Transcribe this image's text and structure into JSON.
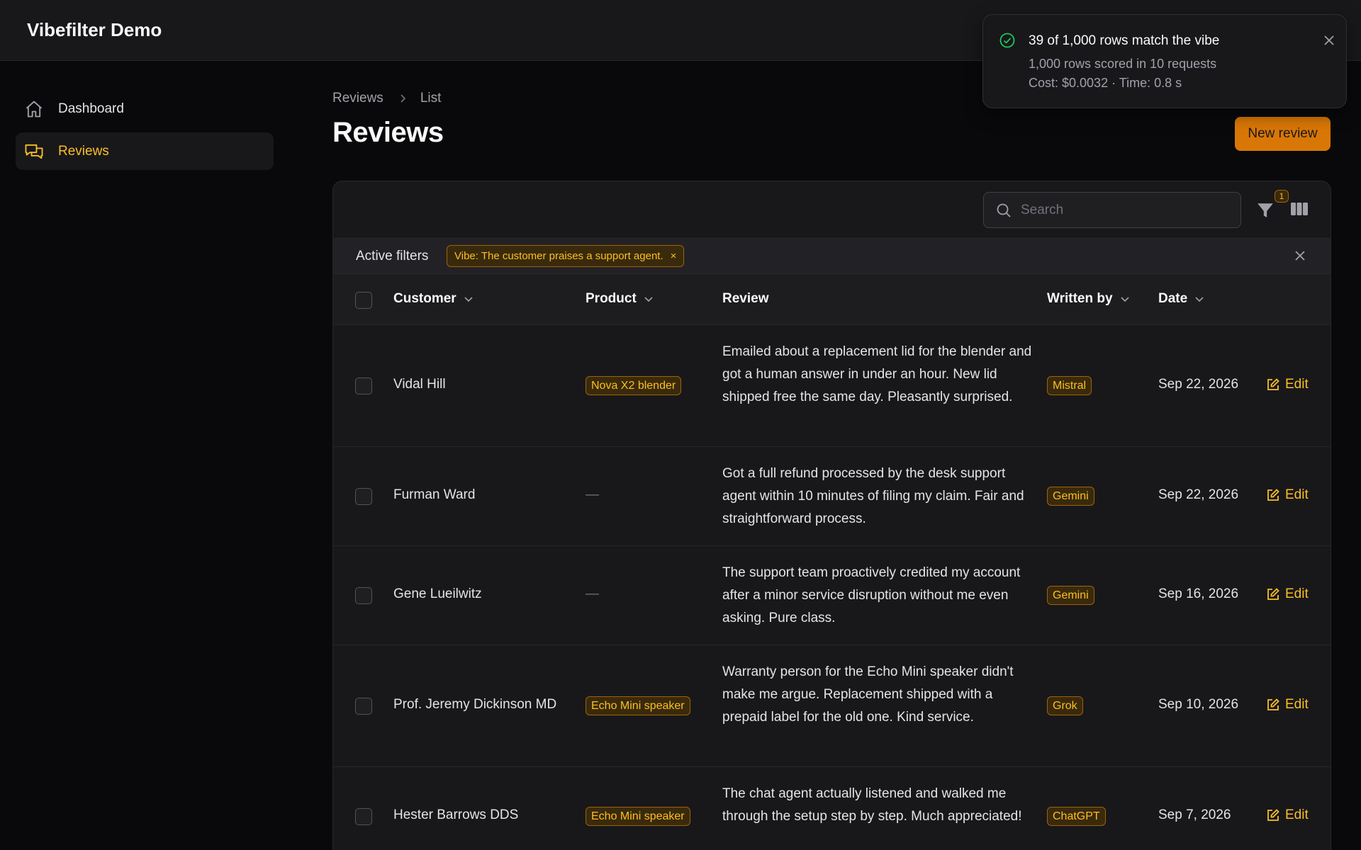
{
  "app": {
    "title": "Vibefilter Demo"
  },
  "sidebar": {
    "items": [
      {
        "label": "Dashboard",
        "icon": "home-icon"
      },
      {
        "label": "Reviews",
        "icon": "chat-bubbles-icon",
        "active": true
      }
    ]
  },
  "breadcrumb": {
    "items": [
      "Reviews",
      "List"
    ]
  },
  "page": {
    "title": "Reviews",
    "new_button": "New review"
  },
  "search": {
    "placeholder": "Search",
    "value": ""
  },
  "toolbar": {
    "filter_count": "1"
  },
  "filters": {
    "label": "Active filters",
    "chips": [
      {
        "label": "Vibe: The customer praises a support agent.",
        "remove": "×"
      }
    ]
  },
  "table": {
    "columns": [
      "Customer",
      "Product",
      "Review",
      "Written by",
      "Date"
    ],
    "empty_product": "—",
    "edit_label": "Edit",
    "rows": [
      {
        "customer": "Vidal Hill",
        "product": "Nova X2 blender",
        "review": "Emailed about a replacement lid for the blender and got a human answer in under an hour. New lid shipped free the same day. Pleasantly surprised.",
        "written_by": "Mistral",
        "date": "Sep 22, 2026"
      },
      {
        "customer": "Furman Ward",
        "product": "",
        "review": "Got a full refund processed by the desk support agent within 10 minutes of filing my claim. Fair and straightforward process.",
        "written_by": "Gemini",
        "date": "Sep 22, 2026"
      },
      {
        "customer": "Gene Lueilwitz",
        "product": "",
        "review": "The support team proactively credited my account after a minor service disruption without me even asking. Pure class.",
        "written_by": "Gemini",
        "date": "Sep 16, 2026"
      },
      {
        "customer": "Prof. Jeremy Dickinson MD",
        "product": "Echo Mini speaker",
        "review": "Warranty person for the Echo Mini speaker didn't make me argue. Replacement shipped with a prepaid label for the old one. Kind service.",
        "written_by": "Grok",
        "date": "Sep 10, 2026"
      },
      {
        "customer": "Hester Barrows DDS",
        "product": "Echo Mini speaker",
        "review": "The chat agent actually listened and walked me through the setup step by step. Much appreciated!",
        "written_by": "ChatGPT",
        "date": "Sep 7, 2026"
      }
    ]
  },
  "toast": {
    "title": "39 of 1,000 rows match the vibe",
    "line1": "1,000 rows scored in 10 requests",
    "line2": "Cost: $0.0032 · Time: 0.8 s"
  },
  "colors": {
    "accent": "#fbbf24",
    "primary_button": "#d97706",
    "success": "#22c55e",
    "background": "#09090b",
    "surface": "#18181b"
  }
}
